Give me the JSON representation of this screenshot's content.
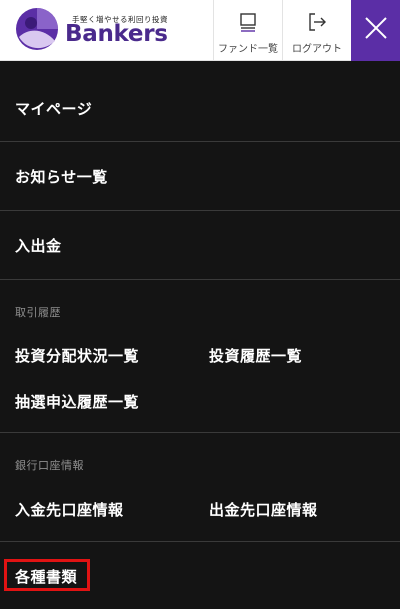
{
  "header": {
    "logo_tagline": "手堅く増やせる利回り投資",
    "logo_word": "Bankers",
    "fund_list_label": "ファンド一覧",
    "logout_label": "ログアウト",
    "brand_color": "#5b2ea6"
  },
  "menu": {
    "mypage": "マイページ",
    "news": "お知らせ一覧",
    "deposit_withdraw": "入出金",
    "transaction_history": {
      "label": "取引履歴",
      "items": [
        "投資分配状況一覧",
        "投資履歴一覧",
        "抽選申込履歴一覧"
      ]
    },
    "bank_account": {
      "label": "銀行口座情報",
      "items": [
        "入金先口座情報",
        "出金先口座情報"
      ]
    },
    "documents": "各種書類"
  }
}
